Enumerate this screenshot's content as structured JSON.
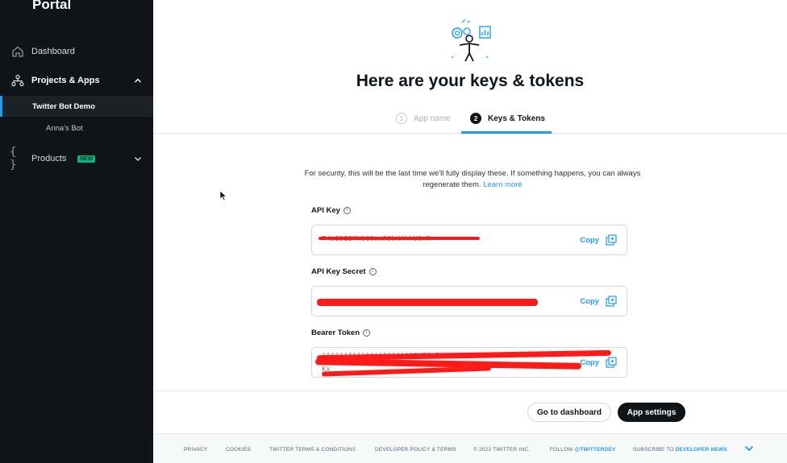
{
  "sidebar": {
    "brand": "Portal",
    "items": [
      {
        "label": "Dashboard",
        "icon": "home-icon"
      },
      {
        "label": "Projects & Apps",
        "icon": "projects-icon"
      },
      {
        "label": "Products",
        "icon": "braces-icon",
        "badge": "NEW"
      }
    ],
    "projects": [
      {
        "label": "Twitter Bot Demo",
        "active": true
      },
      {
        "label": "Anna's Bot",
        "active": false
      }
    ]
  },
  "header": {
    "title": "Here are your keys & tokens",
    "steps": [
      {
        "num": "1",
        "label": "App name",
        "active": false
      },
      {
        "num": "2",
        "label": "Keys & Tokens",
        "active": true
      }
    ]
  },
  "main": {
    "notice": "For security, this will be the last time we'll fully display these. If something happens, you can always regenerate them.",
    "learn_more": "Learn more",
    "fields": [
      {
        "label": "API Key",
        "value": "T4LIDIIFN5CSawR9bKAhkU3xR",
        "copy": "Copy"
      },
      {
        "label": "API Key Secret",
        "value": "",
        "copy": "Copy"
      },
      {
        "label": "Bearer Token",
        "value": "AAAAAAAAAAAAAAAAAAAAAGUR0wEAAAAAP2o%2F",
        "value2": "Kx",
        "copy": "Copy"
      }
    ]
  },
  "actions": {
    "go_dashboard": "Go to dashboard",
    "app_settings": "App settings"
  },
  "footer": {
    "privacy": "PRIVACY",
    "cookies": "COOKIES",
    "terms": "TWITTER TERMS & CONDITIONS",
    "policy": "DEVELOPER POLICY & TERMS",
    "copyright": "© 2022 TWITTER INC.",
    "follow_prefix": "FOLLOW",
    "follow_handle": "@TWITTERDEV",
    "subscribe_prefix": "SUBSCRIBE TO",
    "subscribe_target": "DEVELOPER NEWS"
  },
  "colors": {
    "accent": "#1d9bf0",
    "sidebar_bg": "#101419",
    "redaction": "#ff1a1a"
  }
}
